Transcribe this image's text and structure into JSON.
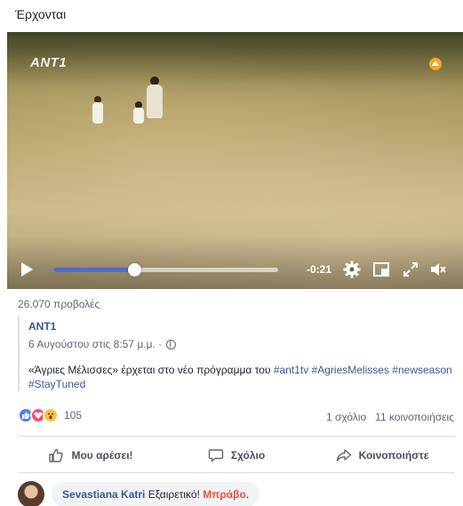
{
  "post": {
    "text": "Έρχονται"
  },
  "video": {
    "logo": "ANT1",
    "time_remaining": "-0:21",
    "progress": 0.36,
    "accent_color": "#4f6ec5"
  },
  "views": "26.070 προβολές",
  "shared": {
    "page_name": "ANT1",
    "date": "6 Αυγούστου στις 8:57 μ.μ. ·",
    "privacy_icon": "globe-icon",
    "description": "«Άγριες Μέλισσες» έρχεται στο νέο πρόγραμμα του",
    "hashtags": [
      "#ant1tv",
      "#AgriesMelisses",
      "#newseason",
      "#StayTuned"
    ]
  },
  "reactions": {
    "icons": [
      "like",
      "love",
      "wow"
    ],
    "count": "105",
    "comments": "1 σχόλιο",
    "shares": "11 κοινοποιήσεις"
  },
  "actions": {
    "like": "Μου αρέσει!",
    "comment": "Σχόλιο",
    "share": "Κοινοποιήστε"
  },
  "comment": {
    "author": "Sevastiana Katri",
    "text": "Εξαιρετικό!",
    "highlight": "Μπράβο",
    "punct": "."
  }
}
